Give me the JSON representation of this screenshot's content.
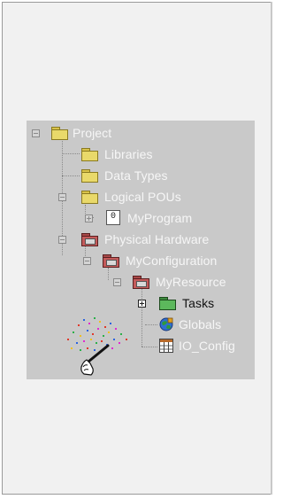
{
  "tree": {
    "root": {
      "label": "Project"
    },
    "libraries": {
      "label": "Libraries"
    },
    "data_types": {
      "label": "Data Types"
    },
    "logical_pous": {
      "label": "Logical POUs"
    },
    "my_program": {
      "label": "MyProgram",
      "icon_text": "0"
    },
    "physical_hardware": {
      "label": "Physical Hardware"
    },
    "my_configuration": {
      "label": "MyConfiguration"
    },
    "my_resource": {
      "label": "MyResource"
    },
    "tasks": {
      "label": "Tasks"
    },
    "globals": {
      "label": "Globals"
    },
    "io_config": {
      "label": "IO_Config"
    }
  },
  "icons": {
    "folder": "folder-icon",
    "hardware": "hardware-folder-icon",
    "tasks": "tasks-folder-icon",
    "globals": "globe-icon",
    "io_config": "table-icon",
    "program": "program-icon",
    "wand": "magic-wand-cursor-icon"
  },
  "colors": {
    "panel_bg": "#c9c9c9",
    "text_light": "#f6f6f6",
    "text_dark": "#111111",
    "background": "#f1f1f1"
  }
}
